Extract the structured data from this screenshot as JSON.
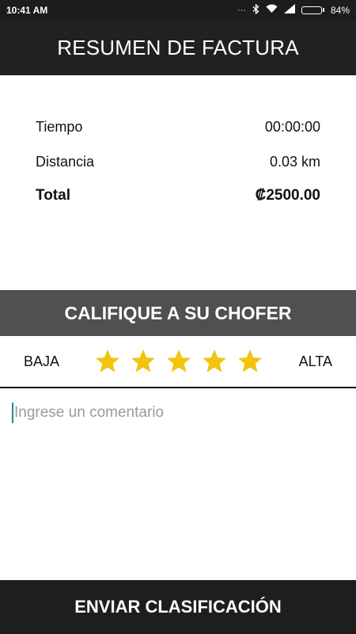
{
  "status_bar": {
    "time": "10:41 AM",
    "battery": "84%",
    "battery_level": 0.84,
    "icons": [
      "signal-dots-icon",
      "bluetooth-icon",
      "wifi-icon",
      "cell-signal-icon",
      "battery-icon"
    ]
  },
  "header": {
    "title": "RESUMEN DE FACTURA"
  },
  "summary": {
    "rows": [
      {
        "label": "Tiempo",
        "value": "00:00:00"
      },
      {
        "label": "Distancia",
        "value": "0.03 km"
      },
      {
        "label": "Total",
        "value": "₡2500.00"
      }
    ]
  },
  "rating": {
    "title": "CALIFIQUE A SU CHOFER",
    "low_label": "BAJA",
    "high_label": "ALTA",
    "stars_total": 5,
    "stars_selected": 5,
    "star_color": "#f2c40f"
  },
  "comment": {
    "placeholder": "Ingrese un comentario",
    "value": ""
  },
  "submit": {
    "label": "ENVIAR CLASIFICACIÓN"
  },
  "colors": {
    "header_bg": "#212121",
    "rate_header_bg": "#505050",
    "caret": "#1a8f8a"
  }
}
